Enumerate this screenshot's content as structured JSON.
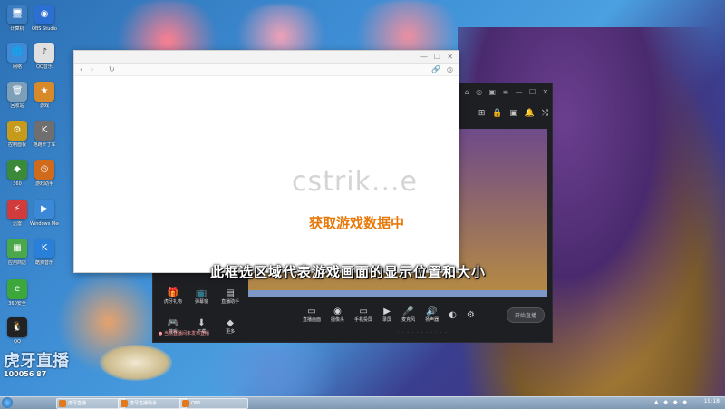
{
  "desktop": {
    "icons": [
      {
        "label": "计算机",
        "glyph": "🖥",
        "color": "#3b7bbf"
      },
      {
        "label": "OBS Studio",
        "glyph": "◉",
        "color": "#2a6fd1"
      },
      {
        "label": "网络",
        "glyph": "🌐",
        "color": "#3d8ad6"
      },
      {
        "label": "QQ音乐",
        "glyph": "♪",
        "color": "#e0e0e0"
      },
      {
        "label": "回收站",
        "glyph": "🗑",
        "color": "#7e9fb8"
      },
      {
        "label": "游戏",
        "glyph": "★",
        "color": "#d88a2a"
      },
      {
        "label": "控制面板",
        "glyph": "⚙",
        "color": "#c69b1b"
      },
      {
        "label": "跑跑卡丁车",
        "glyph": "K",
        "color": "#6f6f6f"
      },
      {
        "label": "360",
        "glyph": "◆",
        "color": "#3a8a3a"
      },
      {
        "label": "游戏助手",
        "glyph": "◎",
        "color": "#d06a1c"
      },
      {
        "label": "迅雷",
        "glyph": "⚡",
        "color": "#d13b3b"
      },
      {
        "label": "Windows Media",
        "glyph": "▶",
        "color": "#3b89d6"
      },
      {
        "label": "应用商店",
        "glyph": "▦",
        "color": "#4aa84a"
      },
      {
        "label": "酷狗音乐",
        "glyph": "K",
        "color": "#2a7fd8"
      },
      {
        "label": "360安全",
        "glyph": "e",
        "color": "#3ca83c"
      },
      {
        "label": "QQ",
        "glyph": "🐧",
        "color": "#222222"
      }
    ],
    "brand": {
      "name": "虎牙直播",
      "subtext": "100056 87"
    }
  },
  "browser": {
    "watermark": "cstrik...e",
    "loading": "获取游戏数据中"
  },
  "subtitle": "此框选区域代表游戏画面的显示位置和大小",
  "stream_app": {
    "header_icons": [
      "⌂",
      "◎",
      "▣",
      "≡",
      "—",
      "☐",
      "✕"
    ],
    "tool_icons": [
      "⊞",
      "🔒",
      "▣",
      "🔔",
      "⤭"
    ],
    "left_tools": [
      {
        "glyph": "🎁",
        "label": "虎牙礼物"
      },
      {
        "glyph": "📺",
        "label": "弹幕窗"
      },
      {
        "glyph": "▤",
        "label": "直播助手"
      },
      {
        "glyph": "🎮",
        "label": "游戏"
      },
      {
        "glyph": "⬇",
        "label": "下载"
      },
      {
        "glyph": "◆",
        "label": "更多"
      }
    ],
    "bottom_tools": [
      {
        "glyph": "▭",
        "label": "直播画面"
      },
      {
        "glyph": "◉",
        "label": "摄像头"
      },
      {
        "glyph": "▭",
        "label": "手机投屏"
      },
      {
        "glyph": "▶",
        "label": "录屏"
      },
      {
        "glyph": "🎤",
        "label": "麦克风"
      },
      {
        "glyph": "🔊",
        "label": "扬声器"
      },
      {
        "glyph": "◐",
        "label": ""
      },
      {
        "glyph": "⚙",
        "label": ""
      }
    ],
    "go_live": "开始直播",
    "status": "● 当前直播间未发布直播",
    "status_right": "· · · · · · · · · · ·"
  },
  "taskbar": {
    "tasks": [
      "虎牙直播",
      "虎牙直播助手",
      "OBS"
    ],
    "tray": "▲ ◆ ◆ ◆",
    "clock": "19:18"
  }
}
